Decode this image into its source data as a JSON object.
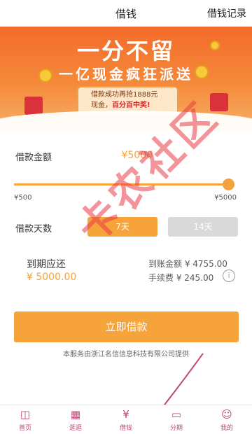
{
  "header": {
    "title": "借钱",
    "record_link": "借钱记录"
  },
  "banner": {
    "headline": "一分不留",
    "subheadline": "一亿现金疯狂派送",
    "promo_line1_prefix": "借款成功再抢",
    "promo_line1_amount": "1888元",
    "promo_line2_prefix": "现金，",
    "promo_line2_highlight": "百分百中奖!"
  },
  "loan": {
    "amount_label": "借款金额",
    "amount_value": "¥5000",
    "min_label": "¥500",
    "max_label": "¥5000",
    "slider_fraction": 1.0,
    "days_label": "借款天数",
    "day_options": [
      "7天",
      "14天"
    ],
    "selected_day": "7天"
  },
  "due": {
    "label": "到期应还",
    "value": "¥ 5000.00",
    "received_text": "到账金额 ¥ 4755.00",
    "fee_text": "手续费 ¥ 245.00"
  },
  "submit_label": "立即借款",
  "footer_note": "本服务由浙江名信信息科技有限公司提供",
  "tabs": [
    {
      "label": "首页",
      "icon": "shopping-bag-icon"
    },
    {
      "label": "逛逛",
      "icon": "grid-icon"
    },
    {
      "label": "借钱",
      "icon": "yen-card-icon"
    },
    {
      "label": "分期",
      "icon": "wallet-icon"
    },
    {
      "label": "我的",
      "icon": "user-icon"
    }
  ],
  "watermark": "卡农社区",
  "colors": {
    "accent": "#f5a33a",
    "banner": "#f36a2a",
    "tab": "#c0467a"
  }
}
